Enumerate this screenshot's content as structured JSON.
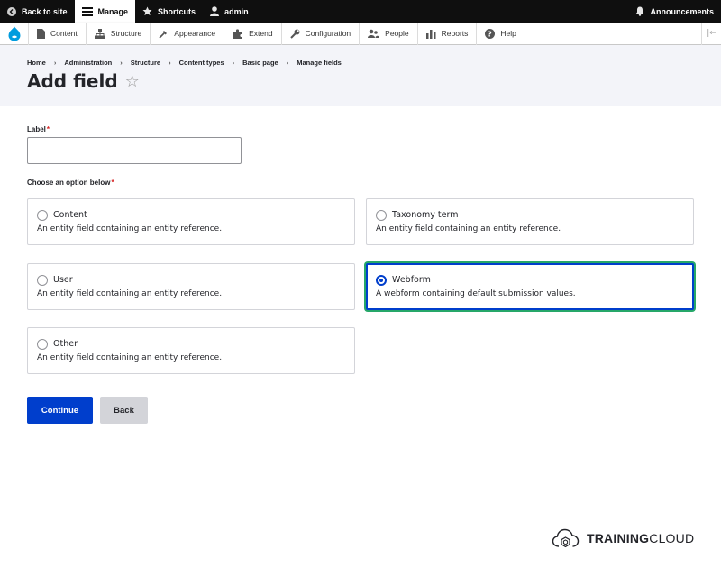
{
  "toolbar": {
    "back_to_site": "Back to site",
    "manage": "Manage",
    "shortcuts": "Shortcuts",
    "user": "admin",
    "announcements": "Announcements"
  },
  "admin_menu": {
    "items": [
      {
        "label": "Content",
        "icon": "page-icon"
      },
      {
        "label": "Structure",
        "icon": "sitemap-icon"
      },
      {
        "label": "Appearance",
        "icon": "paintbrush-icon"
      },
      {
        "label": "Extend",
        "icon": "puzzle-icon"
      },
      {
        "label": "Configuration",
        "icon": "wrench-icon"
      },
      {
        "label": "People",
        "icon": "people-icon"
      },
      {
        "label": "Reports",
        "icon": "bar-chart-icon"
      },
      {
        "label": "Help",
        "icon": "help-icon"
      }
    ]
  },
  "breadcrumb": [
    "Home",
    "Administration",
    "Structure",
    "Content types",
    "Basic page",
    "Manage fields"
  ],
  "page": {
    "title": "Add field"
  },
  "form": {
    "label_field": {
      "label": "Label",
      "value": "",
      "required_mark": "*"
    },
    "choose_label": "Choose an option below",
    "choose_required_mark": "*",
    "options": [
      {
        "title": "Content",
        "description": "An entity field containing an entity reference.",
        "selected": false
      },
      {
        "title": "Taxonomy term",
        "description": "An entity field containing an entity reference.",
        "selected": false
      },
      {
        "title": "User",
        "description": "An entity field containing an entity reference.",
        "selected": false
      },
      {
        "title": "Webform",
        "description": "A webform containing default submission values.",
        "selected": true
      },
      {
        "title": "Other",
        "description": "An entity field containing an entity reference.",
        "selected": false
      }
    ],
    "continue_label": "Continue",
    "back_label": "Back"
  },
  "watermark": {
    "bold": "TRAINING",
    "rest": "CLOUD"
  },
  "colors": {
    "primary": "#003ecc",
    "focus_ring": "#26a769",
    "required": "#d72222",
    "toolbar_bg": "#0f0f0f"
  }
}
